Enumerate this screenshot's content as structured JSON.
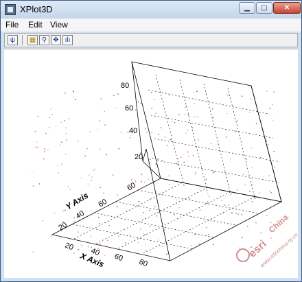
{
  "window": {
    "title": "XPlot3D",
    "buttons": {
      "minimize": "▁",
      "maximize": "▢",
      "close": "✕"
    }
  },
  "menu": [
    "File",
    "Edit",
    "View"
  ],
  "toolbar": {
    "icons": [
      "axes-icon",
      "select-icon",
      "zoom-icon",
      "pan-icon",
      "chart-icon"
    ]
  },
  "plot": {
    "z_ticks": [
      "80",
      "60",
      "40",
      "20"
    ],
    "y_ticks": [
      "60",
      "40",
      "20"
    ],
    "x_ticks": [
      "20",
      "40",
      "60",
      "80"
    ],
    "y_axis_title": "Y Axis",
    "x_axis_title": "X Axis",
    "point_color": "#d0202a"
  },
  "watermark": {
    "logo": "esri",
    "line1": "China",
    "line2": "www.esrichina-bj.cn"
  }
}
